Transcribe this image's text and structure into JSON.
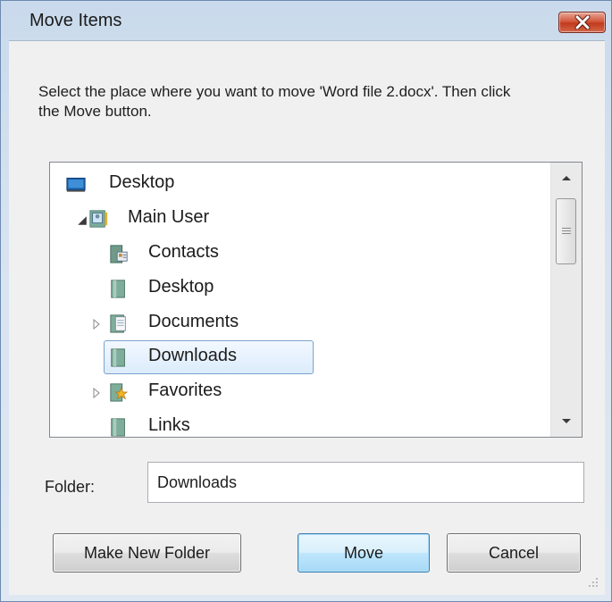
{
  "window": {
    "title": "Move Items",
    "close_icon": "close-icon"
  },
  "instructions": "Select the place where you want to move 'Word file 2.docx'. Then click the Move button.",
  "tree": {
    "items": [
      {
        "label": "Desktop",
        "icon": "desktop-icon",
        "expander": "none"
      },
      {
        "label": "Main User",
        "icon": "user-folder-icon",
        "expander": "expanded"
      },
      {
        "label": "Contacts",
        "icon": "contacts-folder-icon",
        "expander": "none"
      },
      {
        "label": "Desktop",
        "icon": "folder-icon",
        "expander": "none"
      },
      {
        "label": "Documents",
        "icon": "documents-folder-icon",
        "expander": "collapsed"
      },
      {
        "label": "Downloads",
        "icon": "folder-icon",
        "expander": "none",
        "selected": true
      },
      {
        "label": "Favorites",
        "icon": "favorites-folder-icon",
        "expander": "collapsed"
      },
      {
        "label": "Links",
        "icon": "folder-icon",
        "expander": "none"
      }
    ]
  },
  "folder": {
    "label": "Folder:",
    "value": "Downloads"
  },
  "buttons": {
    "make_new_folder": "Make New Folder",
    "move": "Move",
    "cancel": "Cancel"
  },
  "colors": {
    "accent": "#3c7fb1",
    "close": "#c23a1c",
    "selection": "#dcecfc"
  }
}
